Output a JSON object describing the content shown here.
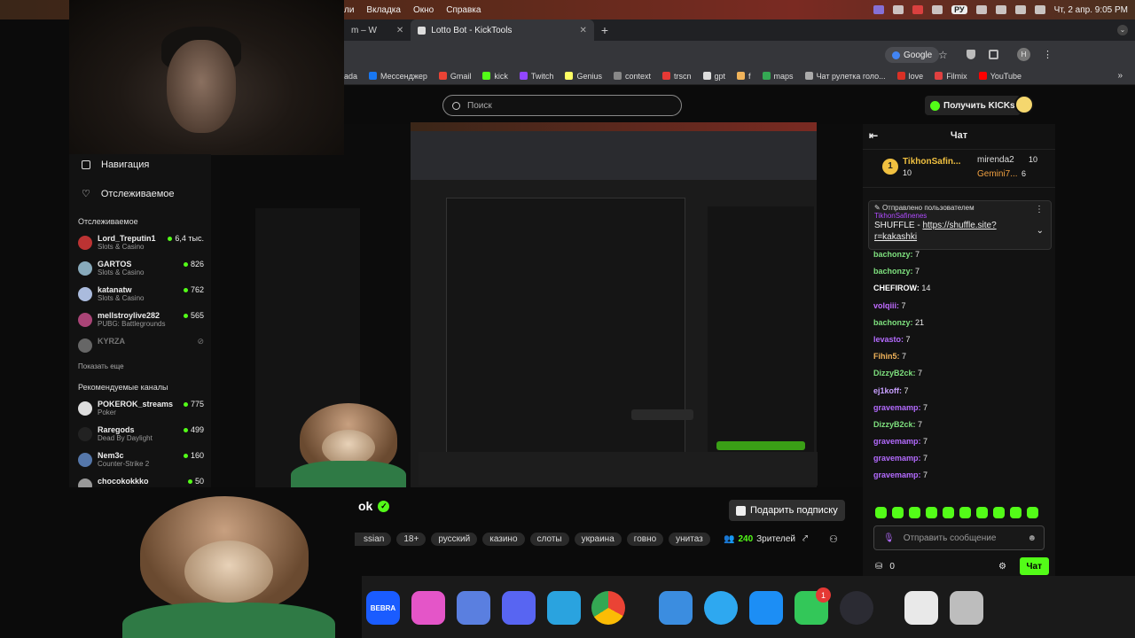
{
  "menubar": {
    "items": [
      "ли",
      "Вкладка",
      "Окно",
      "Справка"
    ],
    "lang": "РУ",
    "datetime": "Чт, 2 апр.  9:05 PM"
  },
  "browser": {
    "tabs": [
      {
        "label": "m – W"
      },
      {
        "label": "Lotto Bot - KickTools"
      }
    ],
    "search_engine": "Google",
    "profile": "H",
    "bookmarks": [
      "ada",
      "Мессенджер",
      "Gmail",
      "kick",
      "Twitch",
      "Genius",
      "context",
      "trscn",
      "gpt",
      "f",
      "maps",
      "Чат рулетка голо...",
      "love",
      "Filmix",
      "YouTube"
    ]
  },
  "site": {
    "search_placeholder": "Поиск",
    "kicks_button": "Получить KICKs"
  },
  "sidebar": {
    "nav_label": "Навигация",
    "following_label": "Отслеживаемое",
    "section_following": "Отслеживаемое",
    "following": [
      {
        "name": "Lord_Treputin1",
        "category": "Slots & Casino",
        "viewers": "6,4 тыс."
      },
      {
        "name": "GARTOS",
        "category": "Slots & Casino",
        "viewers": "826"
      },
      {
        "name": "katanatw",
        "category": "Slots & Casino",
        "viewers": "762"
      },
      {
        "name": "mellstroylive282",
        "category": "PUBG: Battlegrounds",
        "viewers": "565"
      },
      {
        "name": "KYRZA",
        "category": "",
        "viewers": ""
      }
    ],
    "show_more": "Показать еще",
    "section_recommended": "Рекомендуемые каналы",
    "recommended": [
      {
        "name": "POKEROK_streams",
        "category": "Poker",
        "viewers": "775"
      },
      {
        "name": "Raregods",
        "category": "Dead By Daylight",
        "viewers": "499"
      },
      {
        "name": "Nem3c",
        "category": "Counter-Strike 2",
        "viewers": "160"
      },
      {
        "name": "chocokokkko",
        "category": "",
        "viewers": "50"
      }
    ]
  },
  "stream": {
    "title_fragment": "ok",
    "tags": [
      "ssian",
      "18+",
      "русский",
      "казино",
      "слоты",
      "украина",
      "говно",
      "унитаз"
    ],
    "gift_button": "Подарить подписку",
    "viewers": "240",
    "viewers_label": "Зрителей"
  },
  "dock": {
    "bebra": "BEBRA",
    "facetime_badge": "1"
  },
  "chat": {
    "title": "Чат",
    "gifters": [
      {
        "rank": "1",
        "name": "TikhonSafin...",
        "count": "10"
      },
      {
        "name": "mirenda2",
        "count": "10"
      },
      {
        "name": "Gemini7...",
        "count": "6"
      }
    ],
    "pinned_label": "Отправлено пользователем",
    "pinned_user": "TikhonSafinenes",
    "pinned_text": "SHUFFLE - ",
    "pinned_link": "https://shuffle.site?r=kakashki",
    "messages": [
      {
        "user": "bachonzy:",
        "text": "7",
        "color": "#7ee07e"
      },
      {
        "user": "bachonzy:",
        "text": "7",
        "color": "#7ee07e"
      },
      {
        "user": "CHEFIROW:",
        "text": "14",
        "color": "#ffffff"
      },
      {
        "user": "volqiii:",
        "text": "7",
        "color": "#c06bff"
      },
      {
        "user": "bachonzy:",
        "text": "21",
        "color": "#7ee07e"
      },
      {
        "user": "levasto:",
        "text": "7",
        "color": "#b46bff"
      },
      {
        "user": "Fihin5:",
        "text": "7",
        "color": "#f0b35a"
      },
      {
        "user": "DizzyB2ck:",
        "text": "7",
        "color": "#7ee07e"
      },
      {
        "user": "ej1koff:",
        "text": "7",
        "color": "#c8a0ff"
      },
      {
        "user": "gravemamp:",
        "text": "7",
        "color": "#b46bff"
      },
      {
        "user": "DizzyB2ck:",
        "text": "7",
        "color": "#7ee07e"
      },
      {
        "user": "gravemamp:",
        "text": "7",
        "color": "#b46bff"
      },
      {
        "user": "gravemamp:",
        "text": "7",
        "color": "#b46bff"
      },
      {
        "user": "gravemamp:",
        "text": "7",
        "color": "#b46bff"
      }
    ],
    "input_placeholder": "Отправить сообщение",
    "points": "0",
    "send_button": "Чат"
  },
  "colors": {
    "kick_green": "#53fc18",
    "background": "#0b0b0b"
  }
}
